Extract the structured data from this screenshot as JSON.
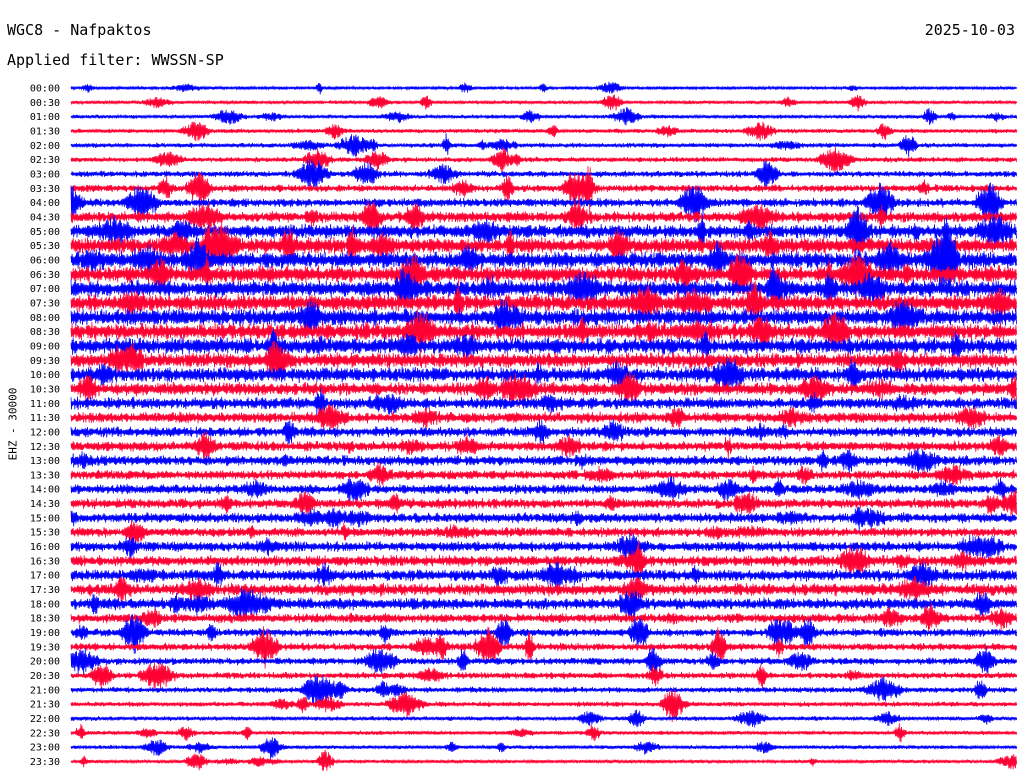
{
  "header": {
    "station": "WGC8 - Nafpaktos",
    "date": "2025-10-03",
    "filter": "Applied filter: WWSSN-SP"
  },
  "chart_data": {
    "type": "line",
    "title": "WGC8 - Nafpaktos",
    "subtitle": "Applied filter: WWSSN-SP",
    "date": "2025-10-03",
    "ylabel": "EHZ - 30000",
    "colors": {
      "odd_rows": "#0000ff",
      "even_rows": "#ff0033",
      "background": "#ffffff"
    },
    "rows": [
      {
        "time": "00:00",
        "activity": 0.08
      },
      {
        "time": "00:30",
        "activity": 0.1
      },
      {
        "time": "01:00",
        "activity": 0.12
      },
      {
        "time": "01:30",
        "activity": 0.15
      },
      {
        "time": "02:00",
        "activity": 0.18
      },
      {
        "time": "02:30",
        "activity": 0.22
      },
      {
        "time": "03:00",
        "activity": 0.28
      },
      {
        "time": "03:30",
        "activity": 0.35
      },
      {
        "time": "04:00",
        "activity": 0.45
      },
      {
        "time": "04:30",
        "activity": 0.6
      },
      {
        "time": "05:00",
        "activity": 0.8
      },
      {
        "time": "05:30",
        "activity": 0.92
      },
      {
        "time": "06:00",
        "activity": 1.0
      },
      {
        "time": "06:30",
        "activity": 1.0
      },
      {
        "time": "07:00",
        "activity": 1.0
      },
      {
        "time": "07:30",
        "activity": 1.0
      },
      {
        "time": "08:00",
        "activity": 1.0
      },
      {
        "time": "08:30",
        "activity": 1.0
      },
      {
        "time": "09:00",
        "activity": 0.95
      },
      {
        "time": "09:30",
        "activity": 0.9
      },
      {
        "time": "10:00",
        "activity": 0.85
      },
      {
        "time": "10:30",
        "activity": 0.75
      },
      {
        "time": "11:00",
        "activity": 0.65
      },
      {
        "time": "11:30",
        "activity": 0.6
      },
      {
        "time": "12:00",
        "activity": 0.55
      },
      {
        "time": "12:30",
        "activity": 0.55
      },
      {
        "time": "13:00",
        "activity": 0.55
      },
      {
        "time": "13:30",
        "activity": 0.5
      },
      {
        "time": "14:00",
        "activity": 0.5
      },
      {
        "time": "14:30",
        "activity": 0.55
      },
      {
        "time": "15:00",
        "activity": 0.55
      },
      {
        "time": "15:30",
        "activity": 0.5
      },
      {
        "time": "16:00",
        "activity": 0.55
      },
      {
        "time": "16:30",
        "activity": 0.6
      },
      {
        "time": "17:00",
        "activity": 0.65
      },
      {
        "time": "17:30",
        "activity": 0.7
      },
      {
        "time": "18:00",
        "activity": 0.65
      },
      {
        "time": "18:30",
        "activity": 0.5
      },
      {
        "time": "19:00",
        "activity": 0.4
      },
      {
        "time": "19:30",
        "activity": 0.38
      },
      {
        "time": "20:00",
        "activity": 0.35
      },
      {
        "time": "20:30",
        "activity": 0.3
      },
      {
        "time": "21:00",
        "activity": 0.25
      },
      {
        "time": "21:30",
        "activity": 0.2
      },
      {
        "time": "22:00",
        "activity": 0.16
      },
      {
        "time": "22:30",
        "activity": 0.14
      },
      {
        "time": "23:00",
        "activity": 0.12
      },
      {
        "time": "23:30",
        "activity": 0.1
      }
    ]
  }
}
